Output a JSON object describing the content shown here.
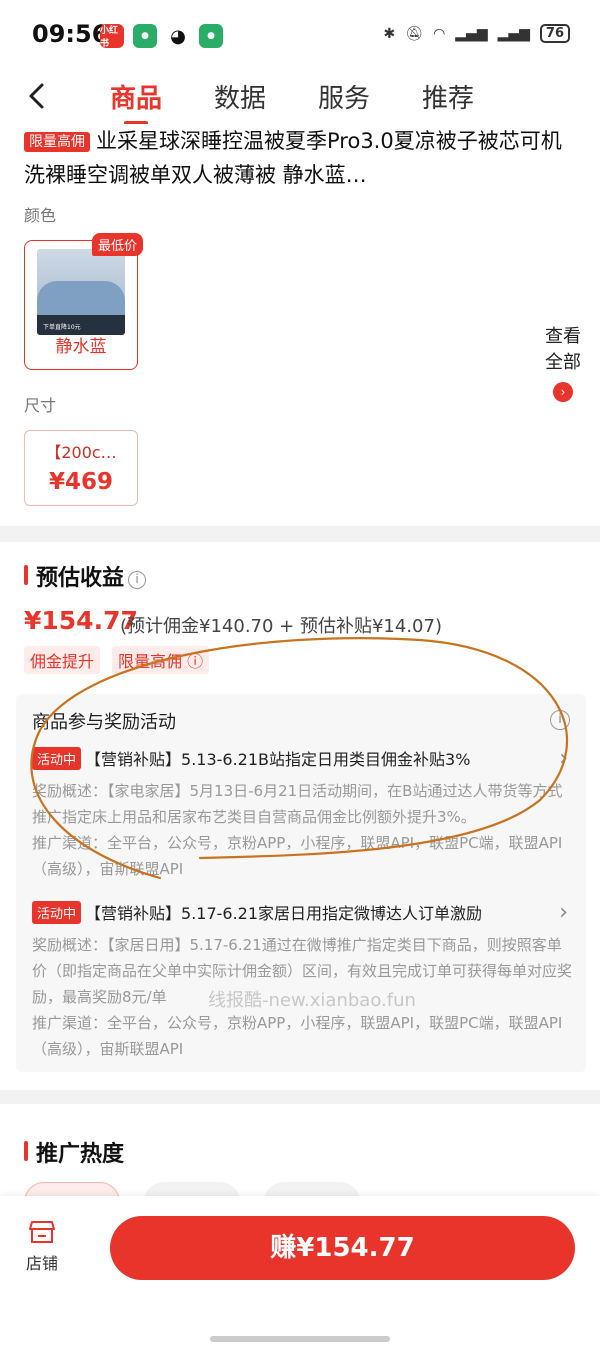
{
  "status_bar": {
    "time": "09:56",
    "apps": [
      {
        "name": "xiaohongshu-icon",
        "label": "小红书",
        "color": "#e8342b"
      },
      {
        "name": "wechat-icon",
        "label": "",
        "color": "#2aae67"
      },
      {
        "name": "qq-icon",
        "label": "",
        "color": "#111111"
      },
      {
        "name": "wechat-icon-2",
        "label": "",
        "color": "#2aae67"
      }
    ],
    "battery": "76"
  },
  "nav": {
    "tabs": [
      "商品",
      "数据",
      "服务",
      "推荐"
    ],
    "active_tab": 0
  },
  "product": {
    "promo_tag": "限量高佣",
    "title": "业采星球深睡控温被夏季Pro3.0夏凉被子被芯可机洗裸睡空调被单双人被薄被 静水蓝…",
    "color_label": "颜色",
    "color_option": {
      "badge": "最低价",
      "name": "静水蓝",
      "img_caption": "下单直降10元"
    },
    "view_all": "查看全部",
    "size_label": "尺寸",
    "size_option": {
      "name": "【200c…",
      "price": "¥469"
    }
  },
  "earnings": {
    "title": "预估收益",
    "amount": "¥154.77",
    "detail": "(预计佣金¥140.70 + 预估补贴¥14.07)",
    "tags": [
      "佣金提升",
      "限量高佣 ⓘ"
    ],
    "activity_header": "商品参与奖励活动",
    "activities": [
      {
        "badge": "活动中",
        "title": "【营销补贴】5.13-6.21B站指定日用类目佣金补贴3%",
        "desc": "奖励概述：【家电家居】5月13日-6月21日活动期间，在B站通过达人带货等方式推广指定床上用品和居家布艺类目自营商品佣金比例额外提升3%。",
        "channels": "推广渠道：全平台，公众号，京粉APP，小程序，联盟API，联盟PC端，联盟API（高级），宙斯联盟API"
      },
      {
        "badge": "活动中",
        "title": "【营销补贴】5.17-6.21家居日用指定微博达人订单激励",
        "desc": "奖励概述：【家居日用】5.17-6.21通过在微博推广指定类目下商品，则按照客单价（即指定商品在父单中实际计佣金额）区间，有效且完成订单可获得每单对应奖励，最高奖励8元/单",
        "channels": "推广渠道：全平台，公众号，京粉APP，小程序，联盟API，联盟PC端，联盟API（高级），宙斯联盟API"
      }
    ]
  },
  "heat": {
    "title": "推广热度"
  },
  "bottom": {
    "store_label": "店铺",
    "earn_button": "赚¥154.77"
  },
  "watermark": "线报酷-new.xianbao.fun",
  "colors": {
    "accent": "#e8342b"
  }
}
